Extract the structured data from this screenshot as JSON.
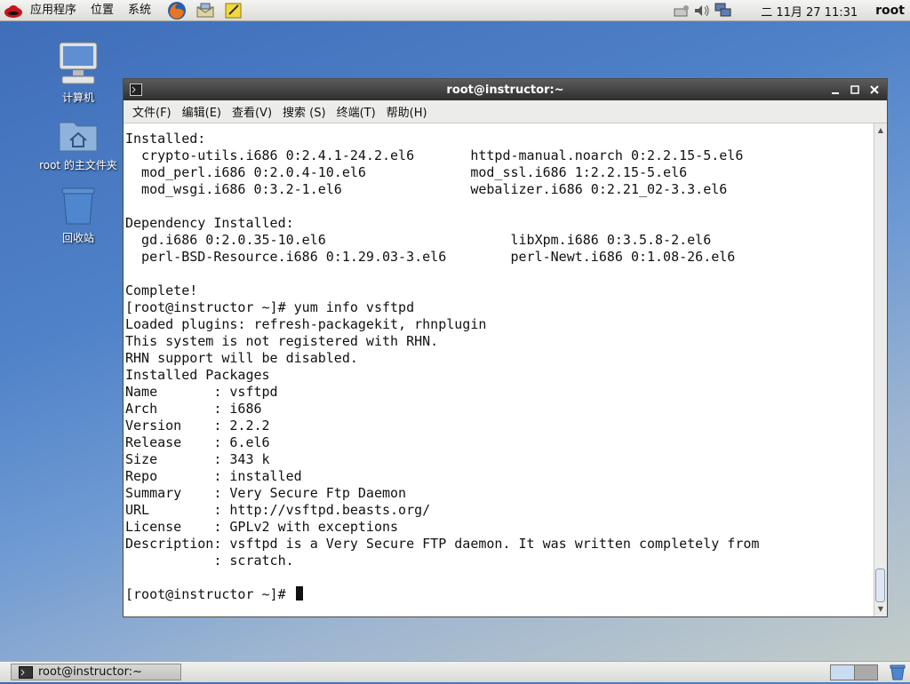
{
  "top_panel": {
    "menus": [
      "应用程序",
      "位置",
      "系统"
    ],
    "launchers": [
      "firefox-icon",
      "mail-icon",
      "notes-icon"
    ],
    "tray_icons": [
      "network-icon",
      "volume-icon",
      "display-icon"
    ],
    "clock": "二 11月 27 11:31",
    "user": "root"
  },
  "desktop": {
    "icons": [
      {
        "label": "计算机",
        "icon": "computer-icon"
      },
      {
        "label": "root 的主文件夹",
        "icon": "home-folder-icon"
      },
      {
        "label": "回收站",
        "icon": "trash-icon"
      }
    ]
  },
  "window": {
    "title": "root@instructor:~",
    "menu": [
      "文件(F)",
      "编辑(E)",
      "查看(V)",
      "搜索 (S)",
      "终端(T)",
      "帮助(H)"
    ]
  },
  "terminal": {
    "lines": [
      "Installed:",
      "  crypto-utils.i686 0:2.4.1-24.2.el6       httpd-manual.noarch 0:2.2.15-5.el6",
      "  mod_perl.i686 0:2.0.4-10.el6             mod_ssl.i686 1:2.2.15-5.el6",
      "  mod_wsgi.i686 0:3.2-1.el6                webalizer.i686 0:2.21_02-3.3.el6",
      "",
      "Dependency Installed:",
      "  gd.i686 0:2.0.35-10.el6                       libXpm.i686 0:3.5.8-2.el6",
      "  perl-BSD-Resource.i686 0:1.29.03-3.el6        perl-Newt.i686 0:1.08-26.el6",
      "",
      "Complete!",
      "[root@instructor ~]# yum info vsftpd",
      "Loaded plugins: refresh-packagekit, rhnplugin",
      "This system is not registered with RHN.",
      "RHN support will be disabled.",
      "Installed Packages",
      "Name       : vsftpd",
      "Arch       : i686",
      "Version    : 2.2.2",
      "Release    : 6.el6",
      "Size       : 343 k",
      "Repo       : installed",
      "Summary    : Very Secure Ftp Daemon",
      "URL        : http://vsftpd.beasts.org/",
      "License    : GPLv2 with exceptions",
      "Description: vsftpd is a Very Secure FTP daemon. It was written completely from",
      "           : scratch.",
      ""
    ],
    "prompt": "[root@instructor ~]# "
  },
  "taskbar": {
    "task_label": "root@instructor:~"
  }
}
